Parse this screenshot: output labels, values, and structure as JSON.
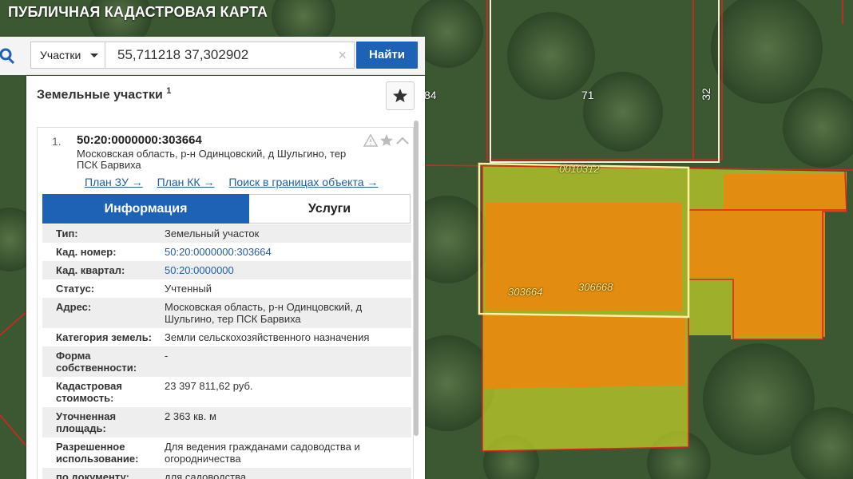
{
  "app": {
    "title": "ПУБЛИЧНАЯ КАДАСТРОВАЯ КАРТА"
  },
  "search": {
    "type_selector": "Участки",
    "query": "55,711218 37,302902",
    "clear_symbol": "×",
    "button": "Найти"
  },
  "panel": {
    "heading": "Земельные участки",
    "count": "1"
  },
  "result": {
    "index": "1.",
    "cad_number": "50:20:0000000:303664",
    "address": "Московская область, р-н Одинцовский, д Шульгино, тер ПСК Барвиха",
    "links": [
      "План ЗУ →",
      "План КК →",
      "Поиск в границах объекта →"
    ],
    "tabs": {
      "info": "Информация",
      "services": "Услуги"
    },
    "fields": [
      {
        "k": "Тип:",
        "v": "Земельный участок"
      },
      {
        "k": "Кад. номер:",
        "v": "50:20:0000000:303664",
        "link": true
      },
      {
        "k": "Кад. квартал:",
        "v": "50:20:0000000",
        "link": true
      },
      {
        "k": "Статус:",
        "v": "Учтенный"
      },
      {
        "k": "Адрес:",
        "v": "Московская область, р-н Одинцовский, д Шульгино, тер ПСК Барвиха"
      },
      {
        "k": "Категория земель:",
        "v": "Земли сельскохозяйственного назначения"
      },
      {
        "k": "Форма собственности:",
        "v": "-"
      },
      {
        "k": "Кадастровая стоимость:",
        "v": "23 397 811,62 руб."
      },
      {
        "k": "Уточненная площадь:",
        "v": "2 363 кв. м"
      },
      {
        "k": "Разрешенное использование:",
        "v": "Для ведения гражданами садоводства и огородничества"
      },
      {
        "k": "по документу:",
        "v": "для садоводства"
      }
    ]
  },
  "map": {
    "labels": [
      "84",
      "71",
      "32",
      "0010312",
      "303664",
      "306668"
    ],
    "colors": {
      "parcel_fill": "#e8890f",
      "quarter_fill": "#c3d128",
      "boundary": "#e0221d",
      "selected": "#fff0a0",
      "forest": "#35502c"
    }
  }
}
